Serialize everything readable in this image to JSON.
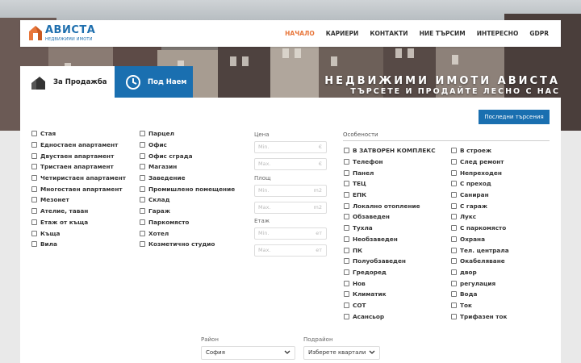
{
  "header": {
    "logo_title": "АВИСТА",
    "logo_sub": "НЕДВИЖИМИ ИМОТИ",
    "nav": [
      {
        "label": "НАЧАЛО",
        "active": true
      },
      {
        "label": "КАРИЕРИ",
        "active": false
      },
      {
        "label": "КОНТАКТИ",
        "active": false
      },
      {
        "label": "НИЕ ТЪРСИМ",
        "active": false
      },
      {
        "label": "ИНТЕРЕСНО",
        "active": false
      },
      {
        "label": "GDPR",
        "active": false
      }
    ]
  },
  "hero": {
    "title": "НЕДВИЖИМИ ИМОТИ АВИСТА",
    "subtitle": "ТЪРСЕТЕ И ПРОДАЙТЕ ЛЕСНО С НАС"
  },
  "tabs": {
    "sale": "За Продажба",
    "rent": "Под Наем"
  },
  "search": {
    "recent_button": "Последни търсения",
    "types_col1": [
      "Стая",
      "Едностаен апартамент",
      "Двустаен апартамент",
      "Тристаен апартамент",
      "Четиристаен апартамент",
      "Многостаен апартамент",
      "Мезонет",
      "Ателие, таван",
      "Етаж от къща",
      "Къща",
      "Вила"
    ],
    "types_col2": [
      "Парцел",
      "Офис",
      "Офис сграда",
      "Магазин",
      "Заведение",
      "Промишлено помещение",
      "Склад",
      "Гараж",
      "Паркомясто",
      "Хотел",
      "Козметично студио"
    ],
    "price_label": "Цена",
    "area_label": "Площ",
    "floor_label": "Етаж",
    "min_placeholder": "Min.",
    "max_placeholder": "Max.",
    "price_unit": "€",
    "area_unit": "m2",
    "floor_unit": "ет",
    "features_label": "Особености",
    "features_col1": [
      "В ЗАТВОРЕН КОМПЛЕКС",
      "Телефон",
      "Панел",
      "ТЕЦ",
      "ЕПК",
      "Локално отопление",
      "Обзаведен",
      "Тухла",
      "Необзаведен",
      "ПК",
      "Полуобзаведен",
      "Гредоред",
      "Нов",
      "Климатик",
      "СОТ",
      "Асансьор"
    ],
    "features_col2": [
      "В строеж",
      "След ремонт",
      "Непреходен",
      "С преход",
      "Саниран",
      "С гараж",
      "Лукс",
      "С паркомясто",
      "Охрана",
      "Тел. централа",
      "Окабеляване",
      "двор",
      "регулация",
      "Вода",
      "Ток",
      "Трифазен ток"
    ],
    "region_label": "Район",
    "region_value": "София",
    "subregion_label": "Подрайон",
    "subregion_value": "Изберете квартали"
  },
  "colors": {
    "accent": "#1a6fb0",
    "nav_active": "#e8763a"
  }
}
